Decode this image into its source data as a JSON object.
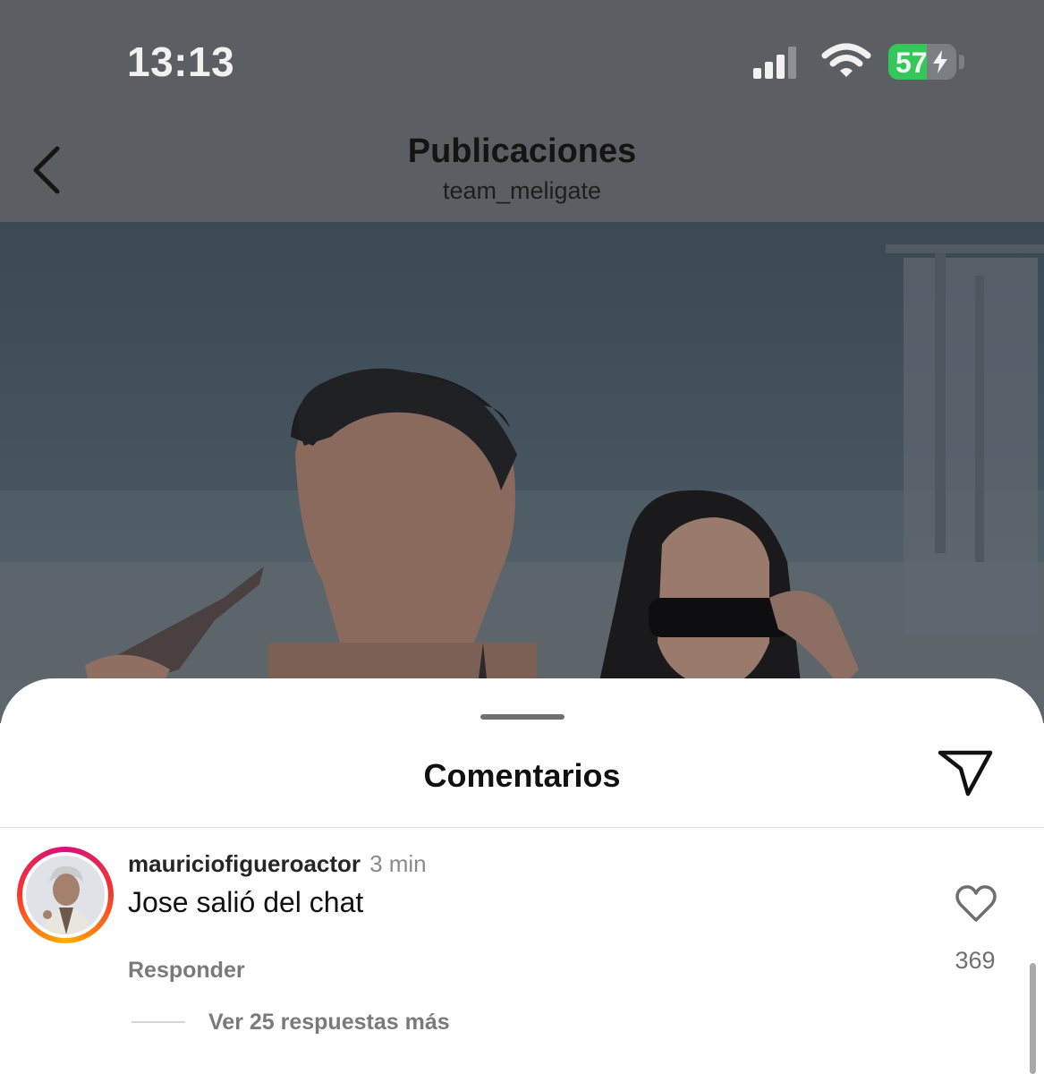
{
  "status_bar": {
    "time": "13:13",
    "battery_percent": "57",
    "battery_level": 0.57,
    "charging": true,
    "icons": [
      "signal-icon",
      "wifi-icon",
      "battery-icon",
      "charging-bolt-icon"
    ]
  },
  "header": {
    "title": "Publicaciones",
    "subtitle": "team_meligate",
    "back_icon": "chevron-left-icon"
  },
  "post": {
    "image": "post-photo"
  },
  "comments_sheet": {
    "title": "Comentarios",
    "share_icon": "send-icon",
    "comments": [
      {
        "username": "mauriciofigueroactor",
        "time": "3 min",
        "text": "Jose salió del chat",
        "likes": "369",
        "reply_label": "Responder",
        "view_replies_label": "Ver 25 respuestas más"
      }
    ]
  },
  "colors": {
    "dim_overlay": "#5b5f63",
    "battery_green": "#34c759",
    "story_ring": [
      "#d3127f",
      "#f6382e",
      "#ffb000"
    ],
    "secondary_text": "#7a7a7a"
  }
}
